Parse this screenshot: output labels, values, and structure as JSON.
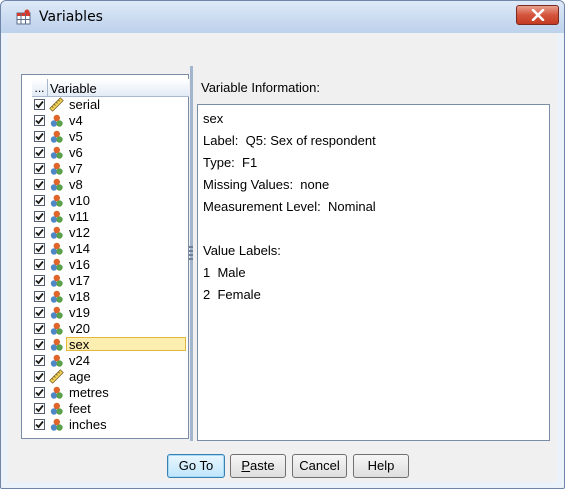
{
  "window": {
    "title": "Variables",
    "close_label": "✕"
  },
  "varlist": {
    "header_dots": "...",
    "header_label": "Variable",
    "selected_index": 16,
    "items": [
      {
        "name": "serial",
        "icon": "ruler-scale-icon",
        "checked": true
      },
      {
        "name": "v4",
        "icon": "nominal-icon",
        "checked": true
      },
      {
        "name": "v5",
        "icon": "nominal-icon",
        "checked": true
      },
      {
        "name": "v6",
        "icon": "nominal-icon",
        "checked": true
      },
      {
        "name": "v7",
        "icon": "nominal-icon",
        "checked": true
      },
      {
        "name": "v8",
        "icon": "nominal-icon",
        "checked": true
      },
      {
        "name": "v10",
        "icon": "nominal-icon",
        "checked": true
      },
      {
        "name": "v11",
        "icon": "nominal-icon",
        "checked": true
      },
      {
        "name": "v12",
        "icon": "nominal-icon",
        "checked": true
      },
      {
        "name": "v14",
        "icon": "nominal-icon",
        "checked": true
      },
      {
        "name": "v16",
        "icon": "nominal-icon",
        "checked": true
      },
      {
        "name": "v17",
        "icon": "nominal-icon",
        "checked": true
      },
      {
        "name": "v18",
        "icon": "nominal-icon",
        "checked": true
      },
      {
        "name": "v19",
        "icon": "nominal-icon",
        "checked": true
      },
      {
        "name": "v20",
        "icon": "nominal-icon",
        "checked": true
      },
      {
        "name": "sex",
        "icon": "nominal-icon",
        "checked": true
      },
      {
        "name": "v24",
        "icon": "nominal-icon",
        "checked": true
      },
      {
        "name": "age",
        "icon": "ruler-scale-icon",
        "checked": true
      },
      {
        "name": "metres",
        "icon": "nominal-icon",
        "checked": true
      },
      {
        "name": "feet",
        "icon": "nominal-icon",
        "checked": true
      },
      {
        "name": "inches",
        "icon": "nominal-icon",
        "checked": true
      }
    ]
  },
  "info": {
    "label": "Variable Information:",
    "lines": [
      "sex",
      "Label:  Q5: Sex of respondent",
      "Type:  F1",
      "Missing Values:  none",
      "Measurement Level:  Nominal",
      "",
      "Value Labels:",
      "1  Male",
      "2  Female"
    ]
  },
  "buttons": {
    "goto": "Go To",
    "paste": "Paste",
    "cancel": "Cancel",
    "help": "Help"
  },
  "colors": {
    "selected_bg": "#fcedb0",
    "close_red": "#c43a22"
  }
}
